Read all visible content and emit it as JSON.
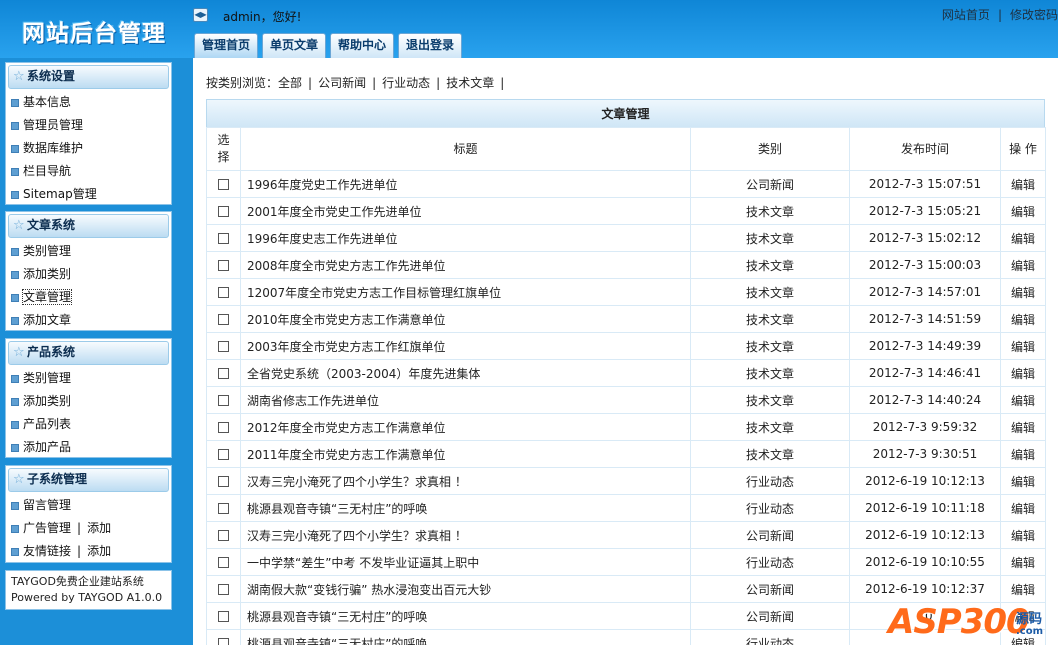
{
  "header": {
    "logo": "网站后台管理",
    "toggle_icon": "◀▶",
    "welcome": "admin，您好!",
    "links": [
      "网站首页",
      "修改密码"
    ],
    "link_sep": "|",
    "tabs": [
      "管理首页",
      "单页文章",
      "帮助中心",
      "退出登录"
    ]
  },
  "sidebar": {
    "panels": [
      {
        "title": "系统设置",
        "items": [
          "基本信息",
          "管理员管理",
          "数据库维护",
          "栏目导航",
          "Sitemap管理"
        ]
      },
      {
        "title": "文章系统",
        "items": [
          "类别管理",
          "添加类别",
          "文章管理",
          "添加文章"
        ]
      },
      {
        "title": "产品系统",
        "items": [
          "类别管理",
          "添加类别",
          "产品列表",
          "添加产品"
        ]
      },
      {
        "title": "子系统管理",
        "items": [
          "留言管理",
          "广告管理",
          "友情链接"
        ],
        "extra": {
          "sep": "|",
          "add": "添加"
        }
      }
    ],
    "footer": {
      "line1": "TAYGOD免费企业建站系统",
      "line2": "Powered by TAYGOD A1.0.0"
    }
  },
  "main": {
    "filter": {
      "label": "按类别浏览：",
      "options": [
        "全部",
        "公司新闻",
        "行业动态",
        "技术文章"
      ],
      "sep": "|"
    },
    "grid": {
      "title": "文章管理",
      "headers": {
        "select": "选择",
        "title": "标题",
        "category": "类别",
        "date": "发布时间",
        "op": "操 作"
      },
      "op_label": "编辑",
      "rows": [
        {
          "title": "1996年度党史工作先进单位",
          "category": "公司新闻",
          "date": "2012-7-3 15:07:51"
        },
        {
          "title": "2001年度全市党史工作先进单位",
          "category": "技术文章",
          "date": "2012-7-3 15:05:21"
        },
        {
          "title": "1996年度史志工作先进单位",
          "category": "技术文章",
          "date": "2012-7-3 15:02:12"
        },
        {
          "title": "2008年度全市党史方志工作先进单位",
          "category": "技术文章",
          "date": "2012-7-3 15:00:03"
        },
        {
          "title": "12007年度全市党史方志工作目标管理红旗单位",
          "category": "技术文章",
          "date": "2012-7-3 14:57:01"
        },
        {
          "title": "2010年度全市党史方志工作满意单位",
          "category": "技术文章",
          "date": "2012-7-3 14:51:59"
        },
        {
          "title": "2003年度全市党史方志工作红旗单位",
          "category": "技术文章",
          "date": "2012-7-3 14:49:39"
        },
        {
          "title": "全省党史系统（2003-2004）年度先进集体",
          "category": "技术文章",
          "date": "2012-7-3 14:46:41"
        },
        {
          "title": "湖南省修志工作先进单位",
          "category": "技术文章",
          "date": "2012-7-3 14:40:24"
        },
        {
          "title": "2012年度全市党史方志工作满意单位",
          "category": "技术文章",
          "date": "2012-7-3 9:59:32"
        },
        {
          "title": "2011年度全市党史方志工作满意单位",
          "category": "技术文章",
          "date": "2012-7-3 9:30:51"
        },
        {
          "title": "汉寿三完小淹死了四个小学生？求真相 ！",
          "category": "行业动态",
          "date": "2012-6-19 10:12:13"
        },
        {
          "title": "桃源县观音寺镇“三无村庄”的呼唤",
          "category": "行业动态",
          "date": "2012-6-19 10:11:18"
        },
        {
          "title": "汉寿三完小淹死了四个小学生？求真相 ！",
          "category": "公司新闻",
          "date": "2012-6-19 10:12:13"
        },
        {
          "title": "一中学禁“差生”中考 不发毕业证逼其上职中",
          "category": "行业动态",
          "date": "2012-6-19 10:10:55"
        },
        {
          "title": "湖南假大款“变钱行骗” 热水浸泡变出百元大钞",
          "category": "公司新闻",
          "date": "2012-6-19 10:12:37"
        },
        {
          "title": "桃源县观音寺镇“三无村庄”的呼唤",
          "category": "公司新闻",
          "date": "20"
        },
        {
          "title": "桃源县观音寺镇“三无村庄”的呼唤",
          "category": "行业动态",
          "date": ""
        }
      ]
    }
  },
  "watermark": {
    "brand": "ASP300",
    "sub": "源码",
    "url": ".com"
  }
}
